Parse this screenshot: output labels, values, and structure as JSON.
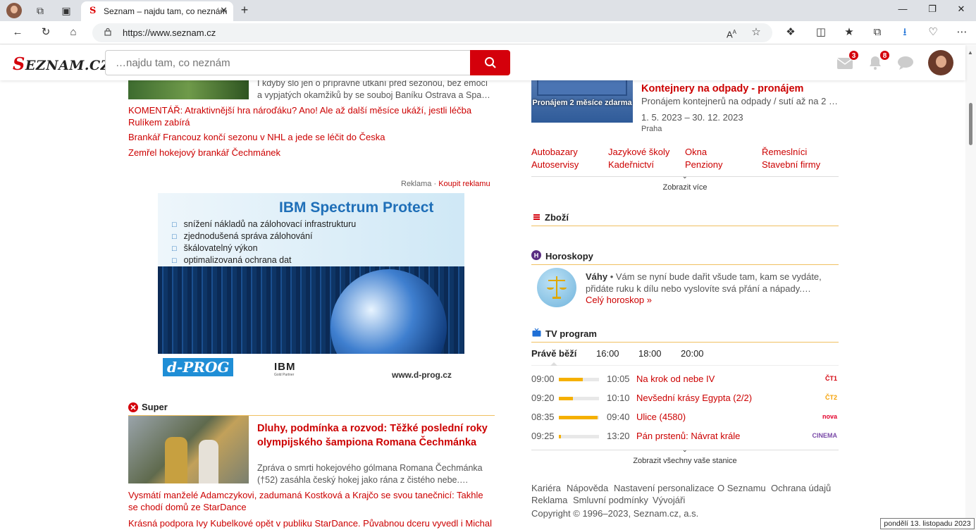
{
  "browser": {
    "tab_title": "Seznam – najdu tam, co neznám",
    "url": "https://www.seznam.cz",
    "read_aloud": "A",
    "read_aloud_sup": "A"
  },
  "header": {
    "logo_initial": "S",
    "logo_rest": "EZNAM.CZ",
    "search_placeholder": "…najdu tam, co neznám",
    "mail_badge": "3",
    "notif_badge": "8"
  },
  "left": {
    "top_perex_1": "I kdyby šlo jen o přípravné utkání před sezonou, bez emocí",
    "top_perex_2": "a vypjatých okamžiků by se souboj Baníku Ostrava a Spa…",
    "links": [
      "KOMENTÁŘ: Atraktivnější hra nároďáku? Ano! Ale až další měsíce ukáží, jestli léčba Rulíkem zabírá",
      "Brankář Francouz končí sezonu v NHL a jede se léčit do Česka",
      "Zemřel hokejový brankář Čechmánek"
    ],
    "ad_label": "Reklama",
    "ad_sep": "·",
    "ad_buy": "Koupit reklamu",
    "ibm": {
      "title": "IBM Spectrum Protect",
      "items": [
        "snížení nákladů na zálohovací infrastrukturu",
        "zjednodušená správa zálohování",
        "škálovatelný výkon",
        "optimalizovaná ochrana dat"
      ],
      "dprog": "d-PROG",
      "ibm_logo": "IBM",
      "ibm_partner": "Gold Partner",
      "web": "www.d-prog.cz"
    },
    "super": {
      "section": "Super",
      "title": "Dluhy, podmínka a rozvod: Těžké poslední roky olympijského šampiona Romana Čechmánka",
      "perex": "Zpráva o smrti hokejového gólmana Romana Čechmánka (†52) zasáhla český hokej jako rána z čistého nebe.…",
      "link_1": "Vysmátí manželé Adamczykovi, zadumaná Kostková a Krajčo se svou tanečnicí: Takhle se chodí domů ze StarDance",
      "link_2": "Krásná podpora Ivy Kubelkové opět v publiku StarDance. Půvabnou dceru vyvedl i Michal"
    }
  },
  "right": {
    "kont": {
      "img_caption": "Pronájem 2 měsíce zdarma",
      "title": "Kontejnery na odpady - pronájem",
      "text": "Pronájem kontejnerů na odpady / sutí až na 2 …",
      "dates": "1. 5. 2023 – 30. 12. 2023",
      "location": "Praha"
    },
    "categories": [
      "Autobazary",
      "Jazykové školy",
      "Okna",
      "Řemeslníci",
      "Autoservisy",
      "Kadeřnictví",
      "Penziony",
      "Stavební firmy"
    ],
    "show_more": "Zobrazit více",
    "zbozi": "Zboží",
    "horoskopy": {
      "section": "Horoskopy",
      "sign": "Váhy",
      "text": " • Vám se nyní bude dařit všude tam, kam se vydáte, přidáte ruku k dílu nebo vyslovíte svá přání a nápady.…",
      "link": "Celý horoskop »"
    },
    "tv": {
      "section": "TV program",
      "tabs": [
        "Právě běží",
        "16:00",
        "18:00",
        "20:00"
      ],
      "rows": [
        {
          "start": "09:00",
          "end": "10:05",
          "title": "Na krok od nebe IV",
          "channel": "ČT1",
          "progress": 0.6
        },
        {
          "start": "09:20",
          "end": "10:10",
          "title": "Nevšední krásy Egypta (2/2)",
          "channel": "ČT2",
          "progress": 0.35
        },
        {
          "start": "08:35",
          "end": "09:40",
          "title": "Ulice (4580)",
          "channel": "nova",
          "progress": 0.97
        },
        {
          "start": "09:25",
          "end": "13:20",
          "title": "Pán prstenů: Návrat krále",
          "channel": "CINEMA",
          "progress": 0.05
        }
      ],
      "show_all": "Zobrazit všechny vaše stanice"
    },
    "footer": {
      "links": [
        "Kariéra",
        "Nápověda",
        "Nastavení personalizace",
        "O Seznamu",
        "Ochrana údajů",
        "Reklama",
        "Smluvní podmínky",
        "Vývojáři"
      ],
      "copyright": "Copyright © 1996–2023, Seznam.cz, a.s."
    }
  },
  "date_tooltip": "pondělí 13. listopadu 2023",
  "colors": {
    "brand_red": "#d4000b",
    "accent_yellow": "#f5b000"
  }
}
